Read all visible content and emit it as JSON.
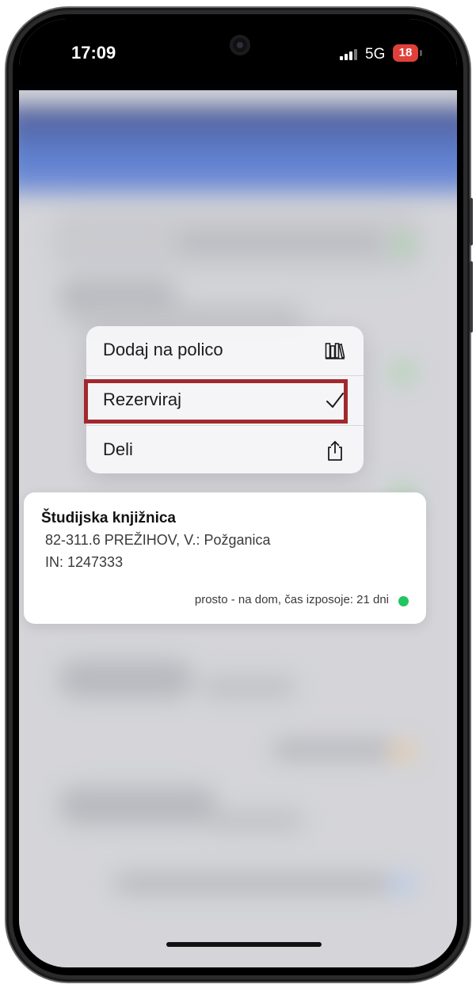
{
  "status_bar": {
    "time": "17:09",
    "network": "5G",
    "battery": "18",
    "battery_color": "#e0403a"
  },
  "context_menu": {
    "items": [
      {
        "label": "Dodaj na polico",
        "icon": "bookshelf-icon"
      },
      {
        "label": "Rezerviraj",
        "icon": "checkmark-icon",
        "highlighted": true
      },
      {
        "label": "Deli",
        "icon": "share-icon"
      }
    ],
    "highlight_color": "#a2282d"
  },
  "holding": {
    "library": "Študijska knjižnica",
    "call_number": "82-311.6 PREŽIHOV, V.: Požganica",
    "inventory": "IN: 1247333",
    "availability": "prosto - na dom, čas izposoje: 21 dni",
    "availability_color": "#22c55e"
  },
  "app_header_color": "#1a4fc8"
}
